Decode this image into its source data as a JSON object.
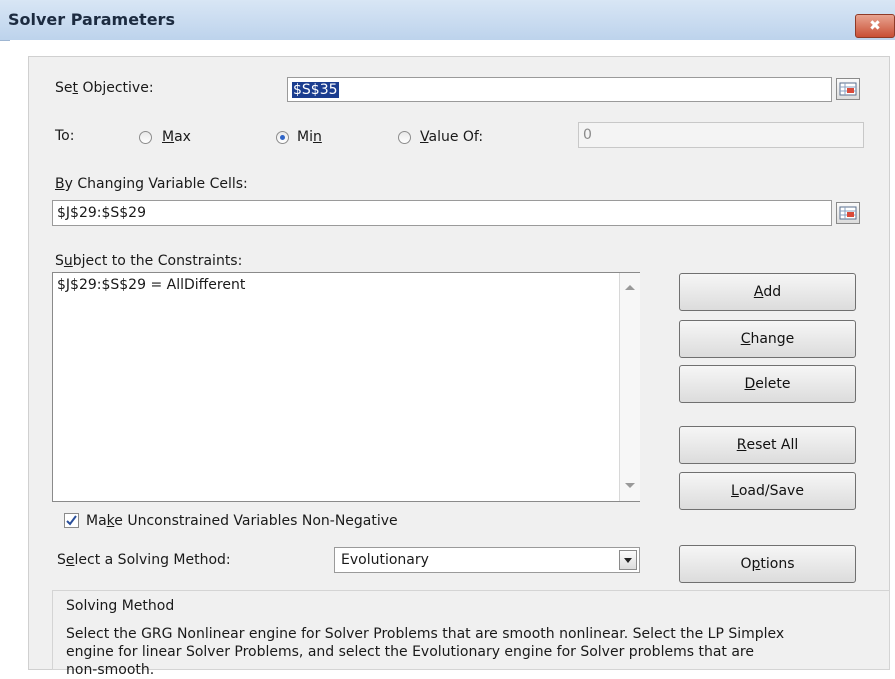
{
  "window": {
    "title": "Solver Parameters",
    "close_label": "✖"
  },
  "objective": {
    "label_pre": "Se",
    "label_ul": "t",
    "label_post": " Objective:",
    "value": "$S$35"
  },
  "to": {
    "label": "To:",
    "max": {
      "pre": "",
      "ul": "M",
      "post": "ax",
      "selected": false
    },
    "min": {
      "pre": "Mi",
      "ul": "n",
      "post": "",
      "selected": true
    },
    "value_of": {
      "pre": "",
      "ul": "V",
      "post": "alue Of:",
      "selected": false,
      "value": "0"
    }
  },
  "changing": {
    "label_pre": "",
    "label_ul": "B",
    "label_post": "y Changing Variable Cells:",
    "value": "$J$29:$S$29"
  },
  "constraints": {
    "label_pre": "S",
    "label_ul": "u",
    "label_post": "bject to the Constraints:",
    "items": [
      "$J$29:$S$29 = AllDifferent"
    ]
  },
  "buttons": {
    "add": {
      "pre": "",
      "ul": "A",
      "post": "dd"
    },
    "change": {
      "pre": "",
      "ul": "C",
      "post": "hange"
    },
    "delete": {
      "pre": "",
      "ul": "D",
      "post": "elete"
    },
    "reset": {
      "pre": "",
      "ul": "R",
      "post": "eset All"
    },
    "loadsave": {
      "pre": "",
      "ul": "L",
      "post": "oad/Save"
    },
    "options": {
      "pre": "O",
      "ul": "p",
      "post": "tions"
    }
  },
  "nonneg": {
    "checked": true,
    "pre": "Ma",
    "ul": "k",
    "post": "e Unconstrained Variables Non-Negative"
  },
  "method": {
    "label_pre": "S",
    "label_ul": "e",
    "label_post": "lect a Solving Method:",
    "value": "Evolutionary"
  },
  "solving_method": {
    "title": "Solving Method",
    "lines": [
      "Select the GRG Nonlinear engine for Solver Problems that are smooth nonlinear. Select the LP Simplex",
      "engine for linear Solver Problems, and select the Evolutionary engine for Solver problems that are",
      "non-smooth."
    ]
  },
  "colors": {
    "title_gradient_top": "#d8e6f5",
    "selection": "#1b3d8f",
    "radio_dot": "#2f64c7"
  }
}
